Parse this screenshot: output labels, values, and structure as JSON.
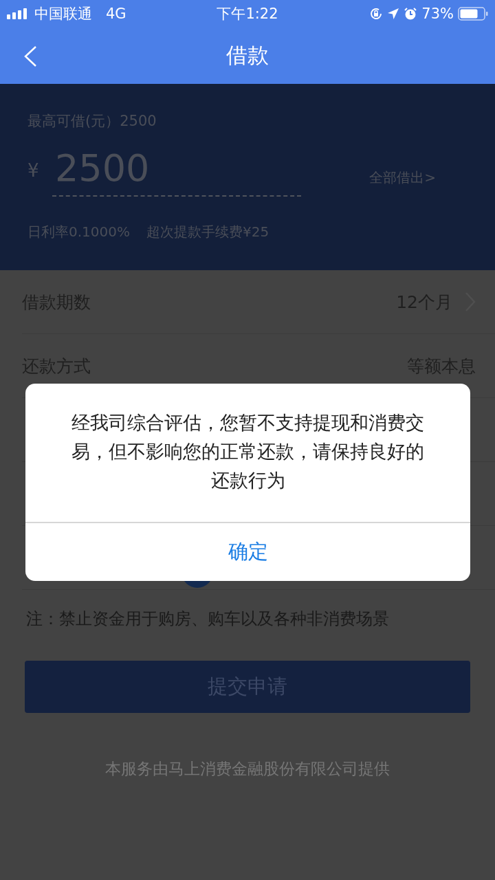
{
  "status_bar": {
    "carrier": "中国联通",
    "network": "4G",
    "time": "下午1:22",
    "battery": "73%"
  },
  "header": {
    "title": "借款"
  },
  "loan_panel": {
    "max_label": "最高可借(元）2500",
    "currency": "¥",
    "amount": "2500",
    "borrow_all": "全部借出>",
    "rate": "日利率0.1000%",
    "fee": "超次提款手续费¥25"
  },
  "rows": [
    {
      "label": "借款期数",
      "value": "12个月",
      "chevron": true
    },
    {
      "label": "还款方式",
      "value": "等额本息",
      "chevron": false
    }
  ],
  "note": "注：禁止资金用于购房、购车以及各种非消费场景",
  "submit": "提交申请",
  "footer": "本服务由马上消费金融股份有限公司提供",
  "dialog": {
    "message": "经我司综合评估，您暂不支持提现和消费交易，但不影响您的正常还款，请保持良好的还款行为",
    "button": "确定"
  }
}
